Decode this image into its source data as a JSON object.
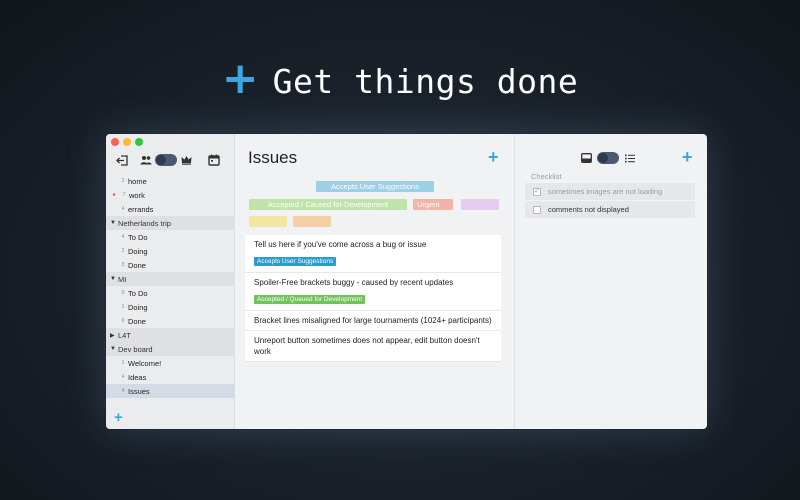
{
  "hero": {
    "icon": "plus-icon",
    "title": "Get things done"
  },
  "sidebar": {
    "groups": [
      {
        "label": "",
        "items": [
          {
            "count": "2",
            "label": "home",
            "marker": ""
          },
          {
            "count": "7",
            "label": "work",
            "marker": "●"
          },
          {
            "count": "4",
            "label": "errands",
            "marker": ""
          }
        ]
      },
      {
        "label": "Netherlands trip",
        "items": [
          {
            "count": "4",
            "label": "To Do"
          },
          {
            "count": "2",
            "label": "Doing"
          },
          {
            "count": "3",
            "label": "Done"
          }
        ]
      },
      {
        "label": "MI",
        "items": [
          {
            "count": "0",
            "label": "To Do"
          },
          {
            "count": "1",
            "label": "Doing"
          },
          {
            "count": "0",
            "label": "Done"
          }
        ]
      },
      {
        "label": "L4T",
        "items": []
      },
      {
        "label": "Dev board",
        "items": [
          {
            "count": "1",
            "label": "Welcome!"
          },
          {
            "count": "4",
            "label": "Ideas"
          },
          {
            "count": "4",
            "label": "Issues"
          }
        ]
      }
    ],
    "add_icon": "+"
  },
  "main": {
    "title": "Issues",
    "add_icon": "+",
    "tags": [
      {
        "label": "Accepts User Suggestions",
        "color": "#9dcfe6"
      },
      {
        "label": "Accepted / Caused for Development",
        "color": "#bfe3a8"
      },
      {
        "label": "Urgent",
        "color": "#f2b4a8"
      },
      {
        "label": "",
        "color": "#e6ccef"
      },
      {
        "label": "",
        "color": "#f3e6a1"
      },
      {
        "label": "",
        "color": "#f7cfa6"
      }
    ],
    "cards": [
      {
        "text": "Tell us here if you've come across a bug or issue",
        "tag": "Accepts User Suggestions",
        "tag_color": "#2b9bd0"
      },
      {
        "text": "Spoiler-Free brackets buggy - caused by recent updates",
        "tag": "Accepted / Queued for Development",
        "tag_color": "#73c15c"
      },
      {
        "text": "Bracket lines misaligned for large tournaments (1024+ participants)",
        "tag": "",
        "tag_color": ""
      },
      {
        "text": "Unreport button sometimes does not appear, edit button doesn't work",
        "tag": "",
        "tag_color": ""
      }
    ]
  },
  "right": {
    "add_icon": "+",
    "checklist_label": "Checklist",
    "items": [
      {
        "label": "sometimes images are not loading",
        "checked": true
      },
      {
        "label": "comments not displayed",
        "checked": false
      }
    ]
  },
  "colors": {
    "accent": "#39a8e0"
  }
}
